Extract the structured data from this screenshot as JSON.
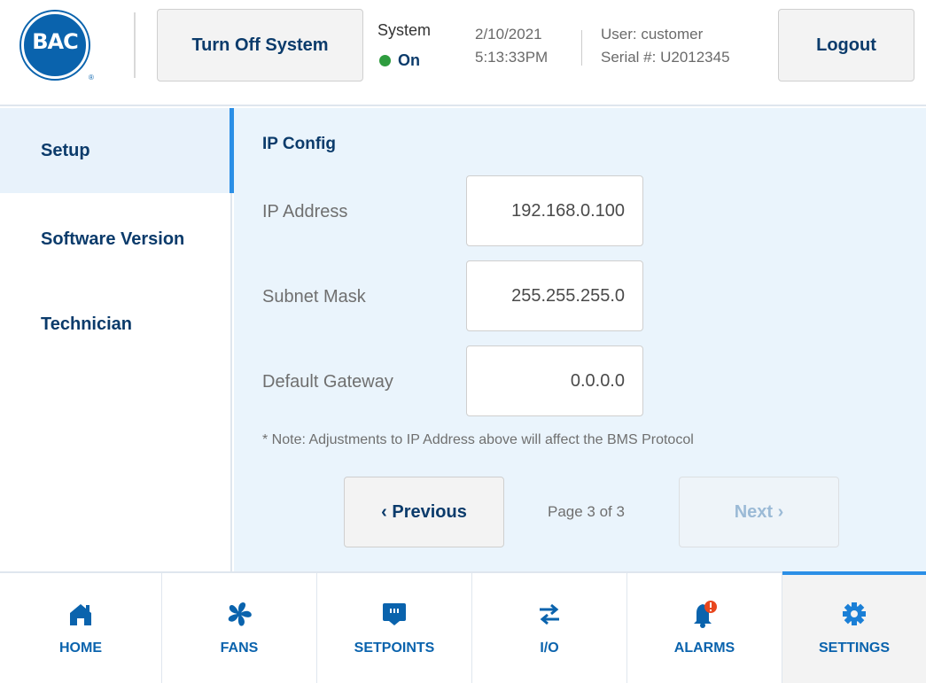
{
  "header": {
    "logo_text": "BAC",
    "logo_reg": "®",
    "turn_off_label": "Turn Off System",
    "system_label": "System",
    "system_state": "On",
    "date": "2/10/2021",
    "time": "5:13:33PM",
    "user": "User: customer",
    "serial": "Serial #: U2012345",
    "logout_label": "Logout"
  },
  "sidebar": {
    "items": [
      {
        "label": "Setup",
        "active": true
      },
      {
        "label": "Software Version",
        "active": false
      },
      {
        "label": "Technician",
        "active": false
      }
    ]
  },
  "main": {
    "title": "IP Config",
    "fields": [
      {
        "label": "IP Address",
        "value": "192.168.0.100"
      },
      {
        "label": "Subnet Mask",
        "value": "255.255.255.0"
      },
      {
        "label": "Default Gateway",
        "value": "0.0.0.0"
      }
    ],
    "note": "* Note: Adjustments to IP Address above will affect the BMS Protocol",
    "previous_label": "‹ Previous",
    "next_label": "Next ›",
    "page_indicator": "Page 3 of 3"
  },
  "nav": {
    "items": [
      {
        "label": "HOME",
        "icon": "home-icon"
      },
      {
        "label": "FANS",
        "icon": "fan-icon"
      },
      {
        "label": "SETPOINTS",
        "icon": "setpoints-icon"
      },
      {
        "label": "I/O",
        "icon": "io-arrows-icon"
      },
      {
        "label": "ALARMS",
        "icon": "alarm-bell-icon"
      },
      {
        "label": "SETTINGS",
        "icon": "gear-icon"
      }
    ],
    "active": "SETTINGS"
  },
  "colors": {
    "brand_blue": "#0a63ad",
    "dark_text": "#0b3b6b",
    "accent": "#2b8fe6",
    "status_green": "#2e9c3e",
    "alert_orange": "#e8471e"
  }
}
